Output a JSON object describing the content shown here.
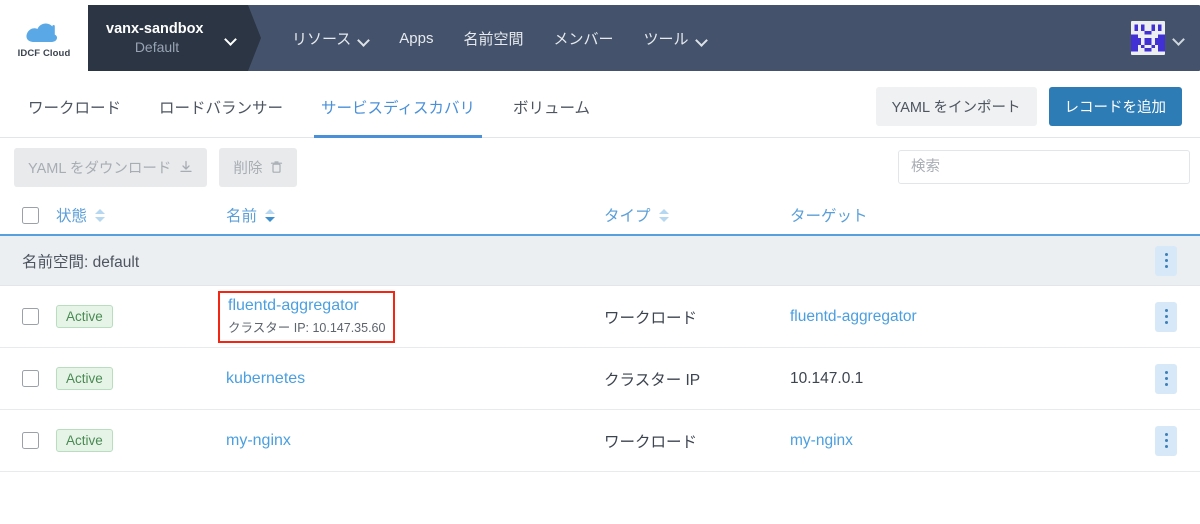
{
  "brand": {
    "logo_icon": "cloud-icon",
    "logo_text": "IDCF Cloud",
    "logo_color": "#5aa9e6"
  },
  "topnav": {
    "context": {
      "name": "vanx-sandbox",
      "subtitle": "Default",
      "chevron_icon": "chevron-down-icon"
    },
    "links": [
      {
        "label": "リソース",
        "has_dropdown": true,
        "icon": "chevron-down-icon"
      },
      {
        "label": "Apps",
        "has_dropdown": false,
        "icon": ""
      },
      {
        "label": "名前空間",
        "has_dropdown": false,
        "icon": ""
      },
      {
        "label": "メンバー",
        "has_dropdown": false,
        "icon": ""
      },
      {
        "label": "ツール",
        "has_dropdown": true,
        "icon": "chevron-down-icon"
      }
    ],
    "account": {
      "avatar_icon": "identicon-avatar",
      "chevron_icon": "chevron-down-icon",
      "avatar_colors": {
        "fg": "#4130d4",
        "bg": "#eceef0"
      }
    },
    "colors": {
      "bar": "#44536b",
      "context_box": "#2b3543"
    }
  },
  "tabs": {
    "items": [
      {
        "label": "ワークロード",
        "active": false
      },
      {
        "label": "ロードバランサー",
        "active": false
      },
      {
        "label": "サービスディスカバリ",
        "active": true
      },
      {
        "label": "ボリューム",
        "active": false
      }
    ],
    "active_color": "#4a90d9",
    "actions": {
      "import_yaml": "YAML をインポート",
      "add_record": "レコードを追加"
    }
  },
  "toolbar": {
    "download_yaml": "YAML をダウンロード",
    "download_icon": "download-icon",
    "delete": "削除",
    "delete_icon": "trash-icon",
    "search_placeholder": "検索",
    "search_value": ""
  },
  "table": {
    "select_all_icon": "checkbox-unchecked-icon",
    "headers": [
      {
        "label": "状態",
        "sortable": true,
        "sort_state": "none",
        "icon": "sort-icon"
      },
      {
        "label": "名前",
        "sortable": true,
        "sort_state": "desc",
        "icon": "sort-icon"
      },
      {
        "label": "タイプ",
        "sortable": true,
        "sort_state": "none",
        "icon": "sort-icon"
      },
      {
        "label": "ターゲット",
        "sortable": false,
        "sort_state": "none",
        "icon": ""
      }
    ],
    "group": {
      "label": "名前空間: default",
      "menu_icon": "kebab-menu-icon"
    },
    "rows": [
      {
        "checkbox_icon": "checkbox-unchecked-icon",
        "status": "Active",
        "name": "fluentd-aggregator",
        "name_sub": "クラスター IP: 10.147.35.60",
        "name_is_link": true,
        "highlighted": true,
        "type": "ワークロード",
        "target": "fluentd-aggregator",
        "target_is_link": true,
        "menu_icon": "kebab-menu-icon"
      },
      {
        "checkbox_icon": "checkbox-unchecked-icon",
        "status": "Active",
        "name": "kubernetes",
        "name_sub": "",
        "name_is_link": true,
        "highlighted": false,
        "type": "クラスター IP",
        "target": "10.147.0.1",
        "target_is_link": false,
        "menu_icon": "kebab-menu-icon"
      },
      {
        "checkbox_icon": "checkbox-unchecked-icon",
        "status": "Active",
        "name": "my-nginx",
        "name_sub": "",
        "name_is_link": true,
        "highlighted": false,
        "type": "ワークロード",
        "target": "my-nginx",
        "target_is_link": true,
        "menu_icon": "kebab-menu-icon"
      }
    ]
  },
  "annotation": {
    "highlight_color": "#f22613"
  }
}
